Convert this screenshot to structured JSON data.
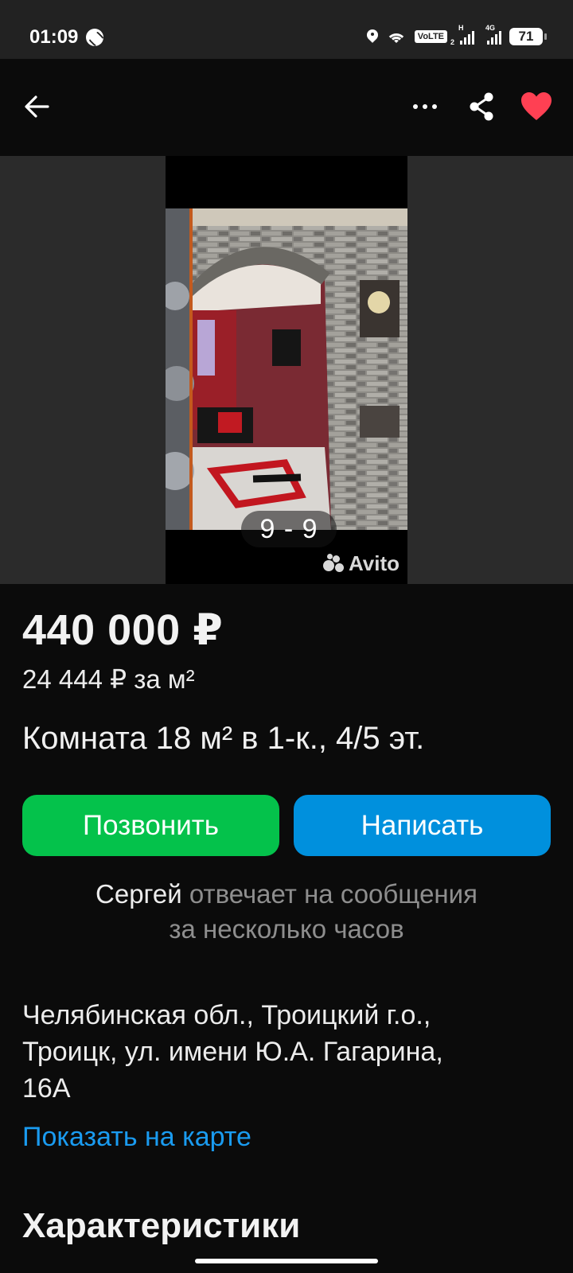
{
  "status_bar": {
    "time": "01:09",
    "volte": "VoLTE",
    "sim_slot": "2",
    "network_h": "H",
    "network_4g": "4G",
    "battery": "71"
  },
  "header": {
    "back_icon": "arrow-left-icon",
    "more_icon": "more-dots-icon",
    "share_icon": "share-icon",
    "favorite_icon": "heart-icon",
    "favorite_color": "#ff4053"
  },
  "gallery": {
    "counter": "9 - 9",
    "watermark": "Avito"
  },
  "listing": {
    "price": "440 000 ₽",
    "price_per_m2": "24 444 ₽ за м²",
    "title": "Комната 18 м² в 1-к., 4/5 эт."
  },
  "actions": {
    "call_label": "Позвонить",
    "call_color": "#04c24b",
    "write_label": "Написать",
    "write_color": "#0090dd"
  },
  "seller": {
    "name": "Сергей",
    "reply_line1": "отвечает на сообщения",
    "reply_line2": "за несколько часов"
  },
  "location": {
    "address_line1": "Челябинская обл., Троицкий г.о.,",
    "address_line2": "Троицк, ул. имени Ю.А. Гагарина,",
    "address_line3": "16А",
    "map_link": "Показать на карте"
  },
  "characteristics": {
    "title": "Характеристики"
  }
}
